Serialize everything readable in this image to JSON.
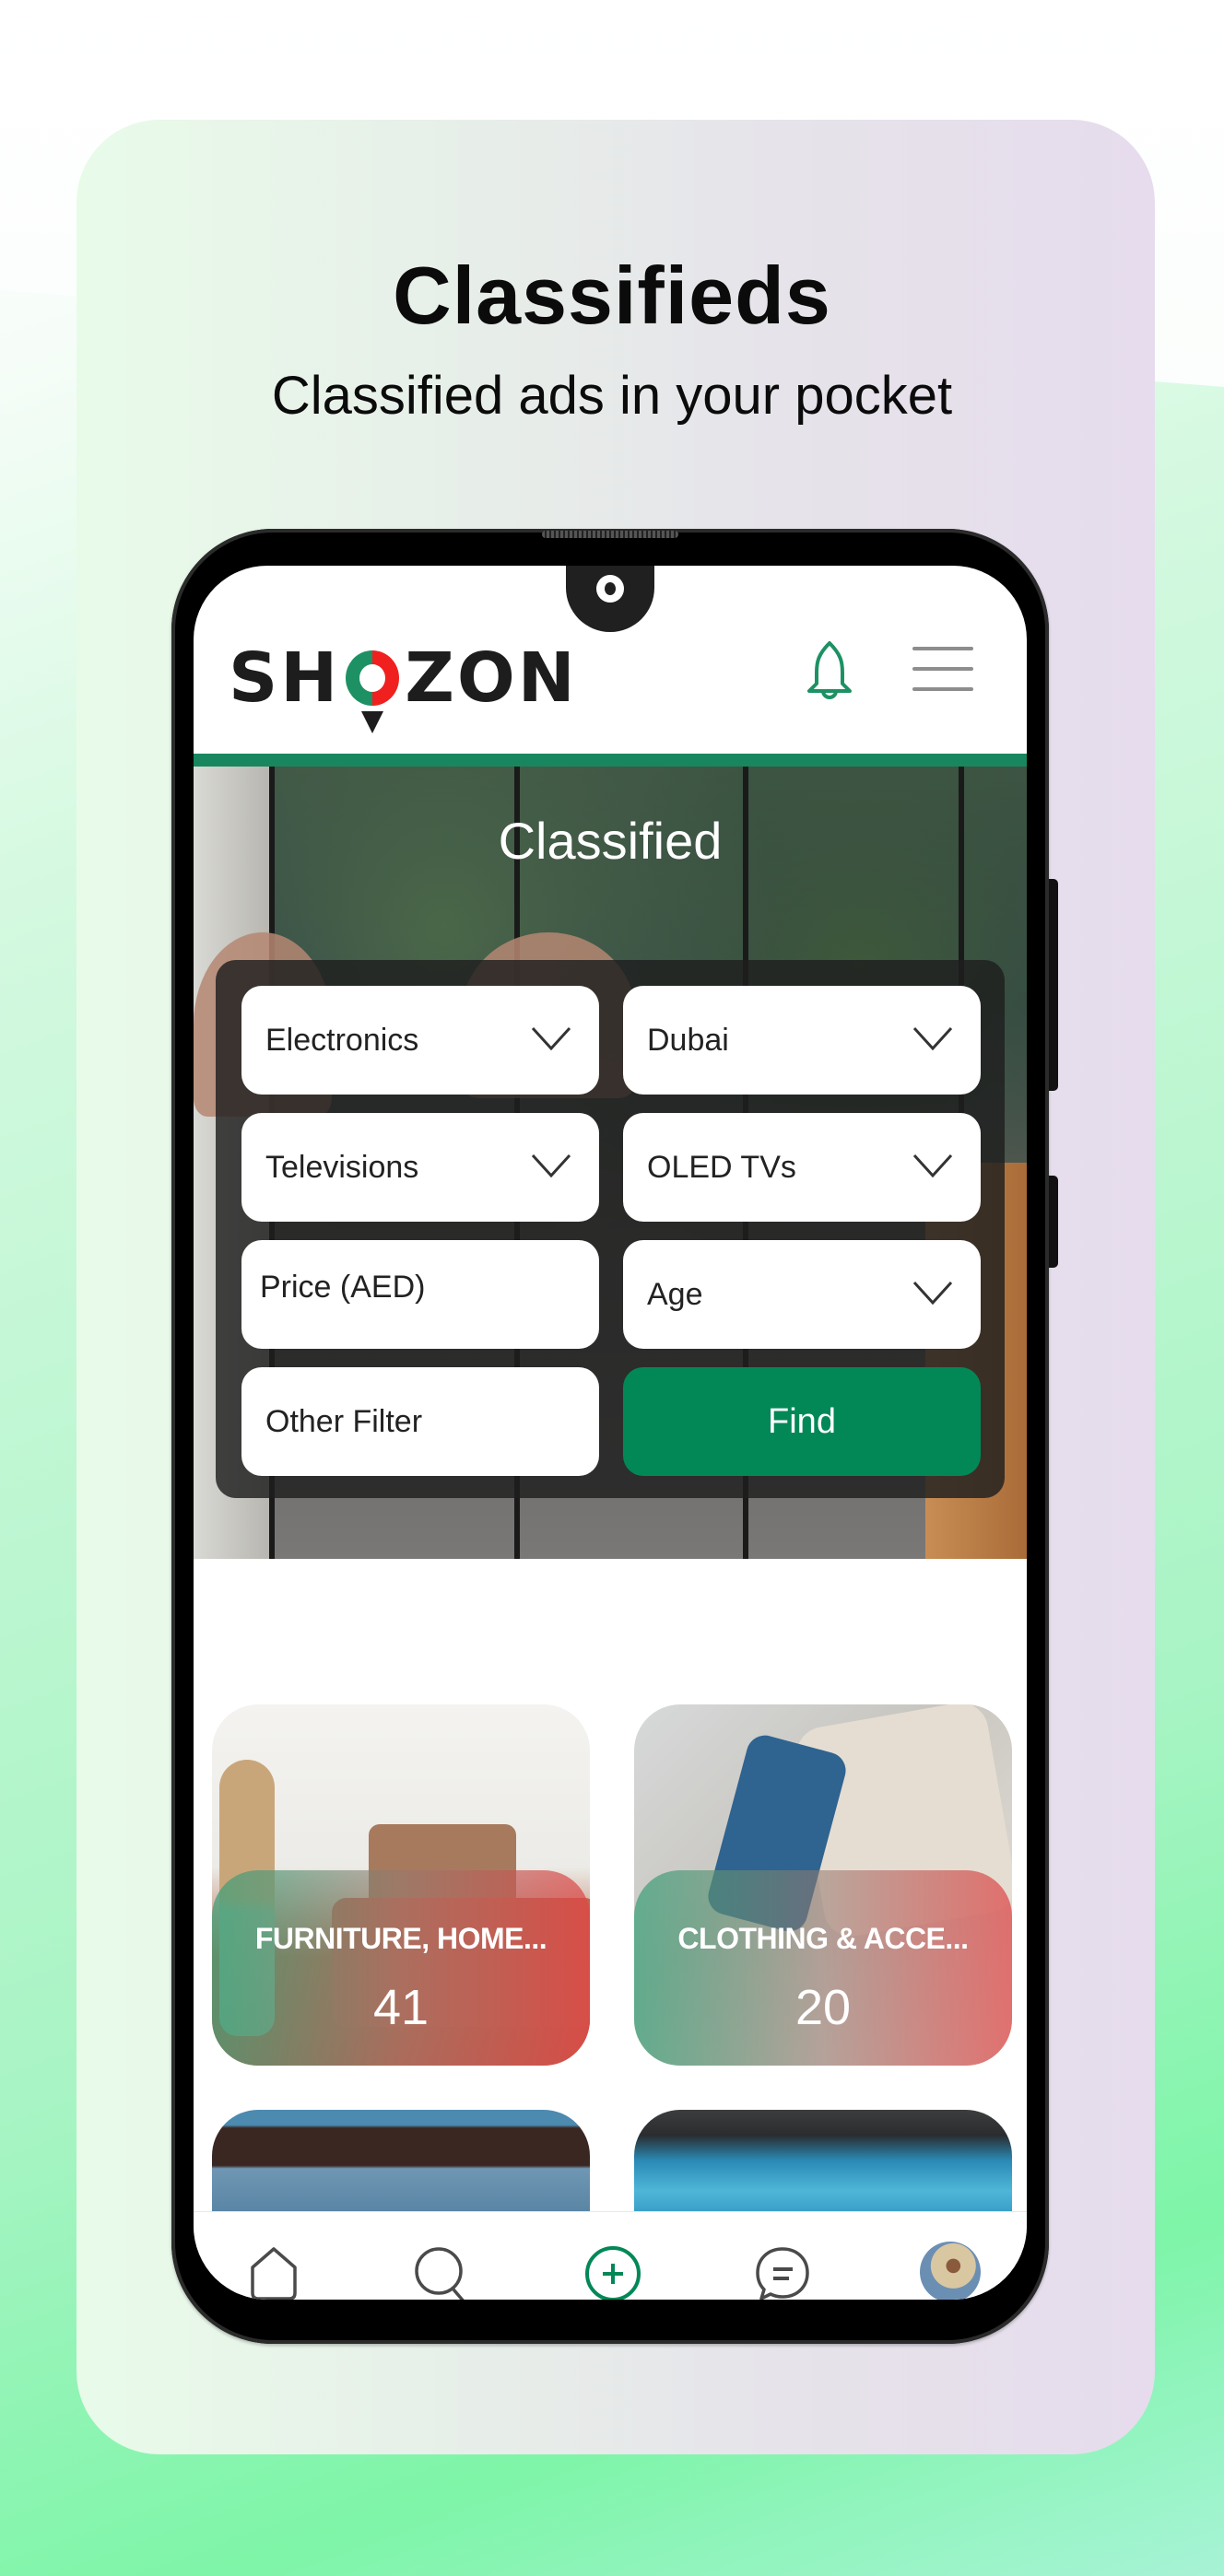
{
  "promo": {
    "title": "Classifieds",
    "subtitle": "Classified ads in your pocket"
  },
  "app": {
    "brand": {
      "prefix": "SH",
      "suffix": "ZON",
      "colors": {
        "green": "#1e9164",
        "red": "#f0201f"
      }
    },
    "header": {
      "bell_icon": "bell-icon",
      "menu_icon": "hamburger-menu-icon"
    },
    "accent_color": "#028857",
    "hero": {
      "title": "Classified"
    },
    "filters": {
      "category": {
        "value": "Electronics"
      },
      "location": {
        "value": "Dubai"
      },
      "subcategory": {
        "value": "Televisions"
      },
      "type": {
        "value": "OLED TVs"
      },
      "price": {
        "placeholder": "Price (AED)"
      },
      "age": {
        "value": "Age"
      },
      "other": {
        "placeholder": "Other Filter"
      },
      "find_label": "Find"
    },
    "categories": [
      {
        "name": "FURNITURE, HOME...",
        "count": "41"
      },
      {
        "name": "CLOTHING & ACCE...",
        "count": "20"
      }
    ],
    "bottom_nav": [
      {
        "name": "home",
        "icon": "home-icon"
      },
      {
        "name": "search",
        "icon": "search-icon"
      },
      {
        "name": "post-ad",
        "icon": "plus-circle-icon"
      },
      {
        "name": "chat",
        "icon": "chat-icon"
      },
      {
        "name": "profile",
        "icon": "avatar"
      }
    ]
  }
}
